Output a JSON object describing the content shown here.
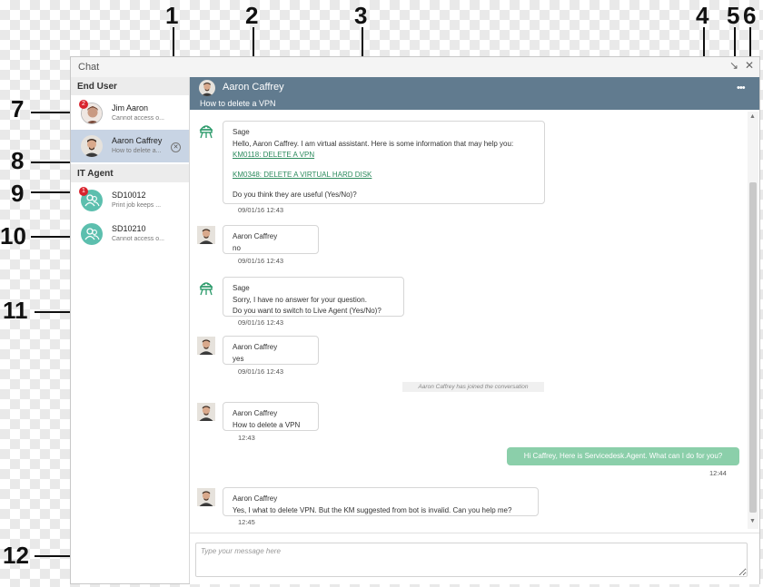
{
  "window": {
    "title": "Chat"
  },
  "sidebar": {
    "end_user_label": "End User",
    "it_agent_label": "IT Agent",
    "end_users": [
      {
        "name": "Jim Aaron",
        "preview": "Cannot access o...",
        "badge": "2"
      },
      {
        "name": "Aaron Caffrey",
        "preview": "How to delete a..."
      }
    ],
    "it_agents": [
      {
        "name": "SD10012",
        "preview": "Print job keeps ...",
        "badge": "1"
      },
      {
        "name": "SD10210",
        "preview": "Cannot access o..."
      }
    ]
  },
  "header": {
    "name": "Aaron Caffrey",
    "subject": "How to delete a VPN",
    "more": "•••"
  },
  "messages": [
    {
      "sender": "Sage",
      "lines": [
        "Hello, Aaron Caffrey. I am virtual assistant. Here is some information that may help you:"
      ],
      "links": [
        "KM0118: DELETE A VPN",
        "KM0348: DELETE A VIRTUAL HARD DISK"
      ],
      "tail": "Do you think they are useful (Yes/No)?",
      "time": "09/01/16 12:43"
    },
    {
      "sender": "Aaron Caffrey",
      "lines": [
        "no"
      ],
      "time": "09/01/16 12:43"
    },
    {
      "sender": "Sage",
      "lines": [
        "Sorry, I have no answer for your question.",
        "Do you want to switch to Live Agent (Yes/No)?"
      ],
      "time": "09/01/16 12:43"
    },
    {
      "sender": "Aaron Caffrey",
      "lines": [
        "yes"
      ],
      "time": "09/01/16 12:43"
    },
    {
      "sender": "Aaron Caffrey",
      "lines": [
        "How to delete a VPN"
      ],
      "time": "12:43"
    },
    {
      "sender": "Aaron Caffrey",
      "lines": [
        "Yes, I what to delete VPN. But the KM suggested from bot is invalid. Can you help me?"
      ],
      "time": "12:45"
    }
  ],
  "system_note": "Aaron Caffrey has joined the conversation",
  "outgoing": {
    "text": "Hi Caffrey, Here is Servicedesk.Agent. What can I do for you?",
    "time": "12:44"
  },
  "composer": {
    "placeholder": "Type your message here"
  },
  "callouts": [
    "1",
    "2",
    "3",
    "4",
    "5",
    "6",
    "7",
    "8",
    "9",
    "10",
    "11",
    "12"
  ]
}
